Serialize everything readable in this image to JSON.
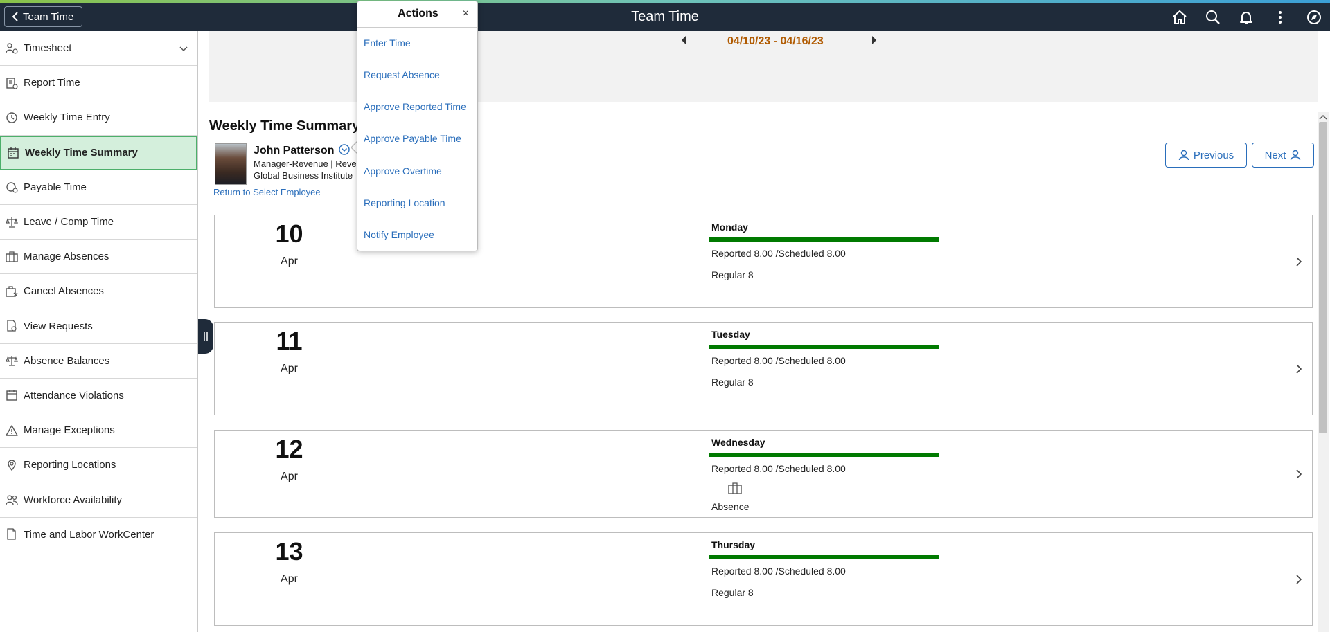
{
  "header": {
    "back_label": "Team Time",
    "title": "Team Time",
    "icons": [
      "home-icon",
      "search-icon",
      "bell-icon",
      "more-vertical-icon",
      "navbar-compass-icon"
    ]
  },
  "sidebar": {
    "items": [
      {
        "label": "Timesheet",
        "icon": "timesheet-icon"
      },
      {
        "label": "Report Time",
        "icon": "report-icon"
      },
      {
        "label": "Weekly Time Entry",
        "icon": "clock-icon"
      },
      {
        "label": "Weekly Time Summary",
        "icon": "calendar-icon"
      },
      {
        "label": "Payable Time",
        "icon": "payable-icon"
      },
      {
        "label": "Leave / Comp Time",
        "icon": "scale-icon"
      },
      {
        "label": "Manage Absences",
        "icon": "briefcase-icon"
      },
      {
        "label": "Cancel Absences",
        "icon": "cancel-briefcase-icon"
      },
      {
        "label": "View Requests",
        "icon": "view-requests-icon"
      },
      {
        "label": "Absence Balances",
        "icon": "balance-icon"
      },
      {
        "label": "Attendance Violations",
        "icon": "attendance-icon"
      },
      {
        "label": "Manage Exceptions",
        "icon": "warning-icon"
      },
      {
        "label": "Reporting Locations",
        "icon": "location-icon"
      },
      {
        "label": "Workforce Availability",
        "icon": "people-icon"
      },
      {
        "label": "Time and Labor WorkCenter",
        "icon": "workcenter-icon"
      }
    ]
  },
  "main": {
    "date_range": "04/10/23 - 04/16/23",
    "page_title": "Weekly Time Summary",
    "employee": {
      "name": "John Patterson",
      "line1": "Manager-Revenue | Reven",
      "line2": "Global Business Institute"
    },
    "return_link": "Return to Select Employee",
    "previous_label": "Previous",
    "next_label": "Next",
    "days": [
      {
        "num": "10",
        "month": "Apr",
        "day": "Monday",
        "reported": "Reported 8.00 /Scheduled 8.00",
        "extra": "Regular 8"
      },
      {
        "num": "11",
        "month": "Apr",
        "day": "Tuesday",
        "reported": "Reported 8.00 /Scheduled 8.00",
        "extra": "Regular 8"
      },
      {
        "num": "12",
        "month": "Apr",
        "day": "Wednesday",
        "reported": "Reported 8.00 /Scheduled 8.00",
        "extra": "Absence"
      },
      {
        "num": "13",
        "month": "Apr",
        "day": "Thursday",
        "reported": "Reported 8.00 /Scheduled 8.00",
        "extra": "Regular 8"
      }
    ]
  },
  "popup": {
    "title": "Actions",
    "close": "×",
    "items": [
      "Enter Time",
      "Request Absence",
      "Approve Reported Time",
      "Approve Payable Time",
      "Approve Overtime",
      "Reporting Location",
      "Notify Employee"
    ]
  },
  "colors": {
    "header_bg": "#1f2b3a",
    "link": "#2a6ebb",
    "date_range": "#b05a00",
    "bar_green": "#007a00",
    "active_bg": "#d4efdc"
  }
}
